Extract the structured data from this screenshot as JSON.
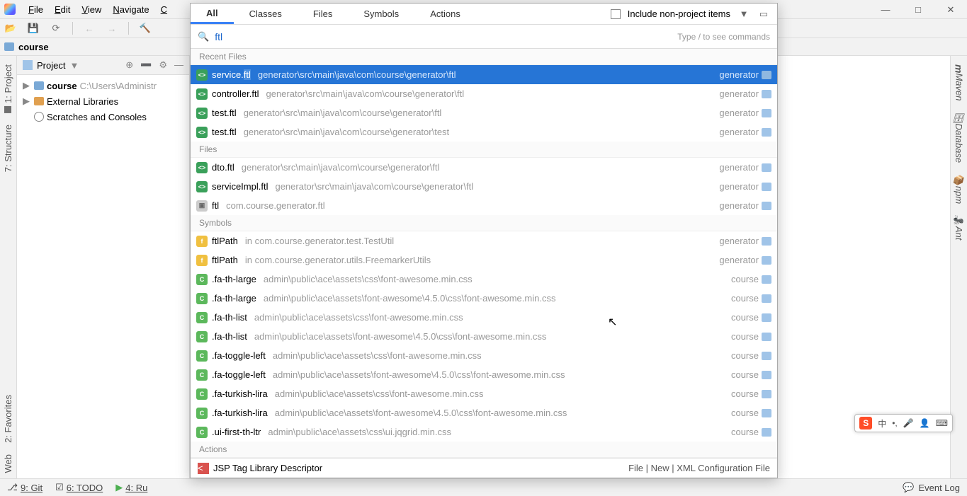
{
  "menubar": {
    "items": [
      "File",
      "Edit",
      "View",
      "Navigate",
      "Code"
    ]
  },
  "window_controls": {
    "min": "—",
    "max": "□",
    "close": "✕"
  },
  "breadcrumb": {
    "project": "course"
  },
  "project_panel": {
    "title": "Project",
    "rows": [
      {
        "kind": "folder",
        "name": "course",
        "path": "C:\\Users\\Administr",
        "caret": "▶"
      },
      {
        "kind": "lib",
        "name": "External Libraries",
        "caret": "▶"
      },
      {
        "kind": "scratch",
        "name": "Scratches and Consoles"
      }
    ]
  },
  "left_tool_tabs": [
    "1: Project",
    "7: Structure"
  ],
  "left_tool_tabs_bottom": [
    "2: Favorites",
    "Web"
  ],
  "right_tool_tabs": [
    "Maven",
    "Database",
    "npm",
    "Ant"
  ],
  "search_popup": {
    "tabs": [
      "All",
      "Classes",
      "Files",
      "Symbols",
      "Actions"
    ],
    "active_tab": 0,
    "checkbox_label": "Include non-project items",
    "input_value": "ftl",
    "input_hint": "Type / to see commands",
    "sections": [
      {
        "title": "Recent Files",
        "rows": [
          {
            "icon": "ftl",
            "name_pre": "service.",
            "name_hl": "ftl",
            "name_post": "",
            "loc": "generator\\src\\main\\java\\com\\course\\generator\\ftl",
            "mod": "generator",
            "sel": true
          },
          {
            "icon": "ftl",
            "name_pre": "controller.ftl",
            "loc": "generator\\src\\main\\java\\com\\course\\generator\\ftl",
            "mod": "generator"
          },
          {
            "icon": "ftl",
            "name_pre": "test.ftl",
            "loc": "generator\\src\\main\\java\\com\\course\\generator\\ftl",
            "mod": "generator"
          },
          {
            "icon": "ftl",
            "name_pre": "test.ftl",
            "loc": "generator\\src\\main\\java\\com\\course\\generator\\test",
            "mod": "generator"
          }
        ]
      },
      {
        "title": "Files",
        "rows": [
          {
            "icon": "ftl",
            "name_pre": "dto.ftl",
            "loc": "generator\\src\\main\\java\\com\\course\\generator\\ftl",
            "mod": "generator"
          },
          {
            "icon": "ftl",
            "name_pre": "serviceImpl.ftl",
            "loc": "generator\\src\\main\\java\\com\\course\\generator\\ftl",
            "mod": "generator"
          },
          {
            "icon": "folder",
            "name_pre": "ftl",
            "loc": "com.course.generator.ftl",
            "mod": "generator"
          }
        ]
      },
      {
        "title": "Symbols",
        "rows": [
          {
            "icon": "field",
            "name_pre": "ftlPath",
            "loc": "in com.course.generator.test.TestUtil",
            "mod": "generator"
          },
          {
            "icon": "field",
            "name_pre": "ftlPath",
            "loc": "in com.course.generator.utils.FreemarkerUtils",
            "mod": "generator"
          },
          {
            "icon": "css",
            "name_pre": ".fa-th-large",
            "loc": "admin\\public\\ace\\assets\\css\\font-awesome.min.css",
            "mod": "course"
          },
          {
            "icon": "css",
            "name_pre": ".fa-th-large",
            "loc": "admin\\public\\ace\\assets\\font-awesome\\4.5.0\\css\\font-awesome.min.css",
            "mod": "course"
          },
          {
            "icon": "css",
            "name_pre": ".fa-th-list",
            "loc": "admin\\public\\ace\\assets\\css\\font-awesome.min.css",
            "mod": "course"
          },
          {
            "icon": "css",
            "name_pre": ".fa-th-list",
            "loc": "admin\\public\\ace\\assets\\font-awesome\\4.5.0\\css\\font-awesome.min.css",
            "mod": "course"
          },
          {
            "icon": "css",
            "name_pre": ".fa-toggle-left",
            "loc": "admin\\public\\ace\\assets\\css\\font-awesome.min.css",
            "mod": "course"
          },
          {
            "icon": "css",
            "name_pre": ".fa-toggle-left",
            "loc": "admin\\public\\ace\\assets\\font-awesome\\4.5.0\\css\\font-awesome.min.css",
            "mod": "course"
          },
          {
            "icon": "css",
            "name_pre": ".fa-turkish-lira",
            "loc": "admin\\public\\ace\\assets\\css\\font-awesome.min.css",
            "mod": "course"
          },
          {
            "icon": "css",
            "name_pre": ".fa-turkish-lira",
            "loc": "admin\\public\\ace\\assets\\font-awesome\\4.5.0\\css\\font-awesome.min.css",
            "mod": "course"
          },
          {
            "icon": "css",
            "name_pre": ".ui-first-th-ltr",
            "loc": "admin\\public\\ace\\assets\\css\\ui.jqgrid.min.css",
            "mod": "course"
          }
        ]
      },
      {
        "title": "Actions",
        "rows": []
      }
    ],
    "footer_left": "JSP Tag Library Descriptor",
    "footer_right": "File | New | XML Configuration File"
  },
  "statusbar": {
    "items": [
      "9: Git",
      "6: TODO",
      "4: Ru"
    ],
    "event_log": "Event Log"
  },
  "ime": {
    "logo": "S",
    "items": [
      "中",
      "•,",
      "🎤",
      "👤",
      "⌨"
    ]
  }
}
